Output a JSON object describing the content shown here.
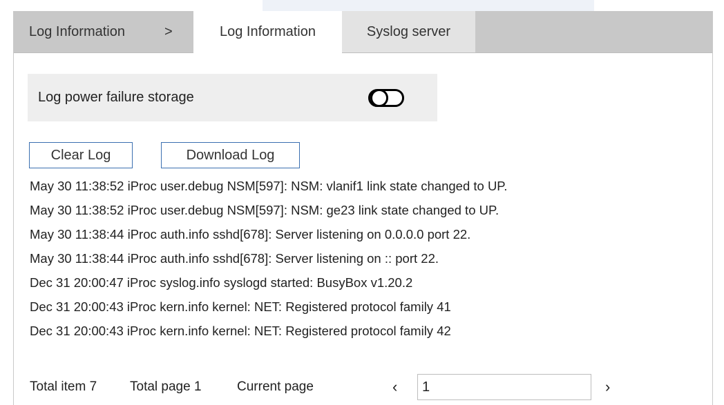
{
  "breadcrumb": {
    "label": "Log Information",
    "separator": ">"
  },
  "tabs": [
    {
      "label": "Log Information",
      "active": true
    },
    {
      "label": "Syslog server",
      "active": false
    }
  ],
  "setting": {
    "label": "Log power failure storage",
    "toggle_on": false
  },
  "buttons": {
    "clear_label": "Clear Log",
    "download_label": "Download Log"
  },
  "logs": [
    "May 30 11:38:52 iProc user.debug NSM[597]: NSM: vlanif1 link state changed to UP.",
    "May 30 11:38:52 iProc user.debug NSM[597]: NSM: ge23 link state changed to UP.",
    "May 30 11:38:44 iProc auth.info sshd[678]: Server listening on 0.0.0.0 port 22.",
    "May 30 11:38:44 iProc auth.info sshd[678]: Server listening on :: port 22.",
    "Dec 31 20:00:47 iProc syslog.info syslogd started: BusyBox v1.20.2",
    "Dec 31 20:00:43 iProc kern.info kernel: NET: Registered protocol family 41",
    "Dec 31 20:00:43 iProc kern.info kernel: NET: Registered protocol family 42"
  ],
  "pager": {
    "total_item": "Total item 7",
    "total_page": "Total page 1",
    "current_page_label": "Current page",
    "prev_icon": "‹",
    "next_icon": "›",
    "current_page_value": "1"
  },
  "colors": {
    "tab_bar": "#c8c8c8",
    "button_border": "#3a6fb0",
    "setting_bg": "#eeeeee"
  }
}
